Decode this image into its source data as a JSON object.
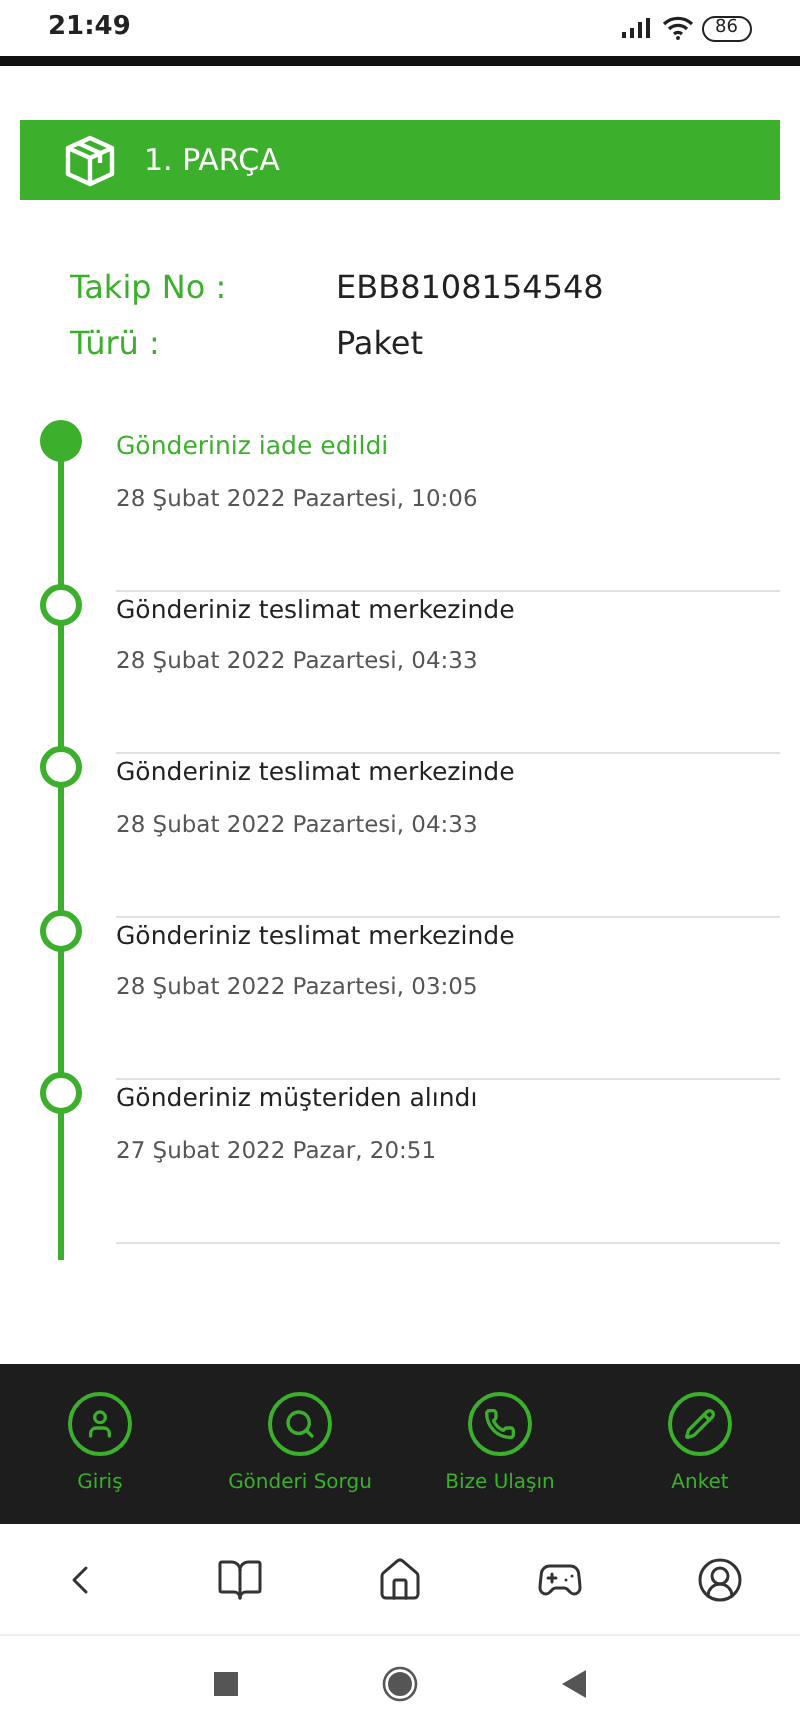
{
  "status_bar": {
    "time": "21:49",
    "battery": "86"
  },
  "header": {
    "title": "1. PARÇA"
  },
  "info": [
    {
      "label": "Takip No :",
      "value": "EBB8108154548"
    },
    {
      "label": "Türü :",
      "value": "Paket"
    }
  ],
  "timeline": [
    {
      "title": "Gönderiniz iade edildi",
      "date": "28 Şubat 2022 Pazartesi, 10:06",
      "current": true
    },
    {
      "title": "Gönderiniz teslimat merkezinde",
      "date": "28 Şubat 2022 Pazartesi, 04:33",
      "current": false
    },
    {
      "title": "Gönderiniz teslimat merkezinde",
      "date": "28 Şubat 2022 Pazartesi, 04:33",
      "current": false
    },
    {
      "title": "Gönderiniz teslimat merkezinde",
      "date": "28 Şubat 2022 Pazartesi, 03:05",
      "current": false
    },
    {
      "title": "Gönderiniz müşteriden alındı",
      "date": "27 Şubat 2022 Pazar, 20:51",
      "current": false
    }
  ],
  "bottom_nav": [
    {
      "kind": "user",
      "label": "Giriş"
    },
    {
      "kind": "search",
      "label": "Gönderi Sorgu"
    },
    {
      "kind": "phone",
      "label": "Bize Ulaşın"
    },
    {
      "kind": "pencil",
      "label": "Anket"
    }
  ]
}
